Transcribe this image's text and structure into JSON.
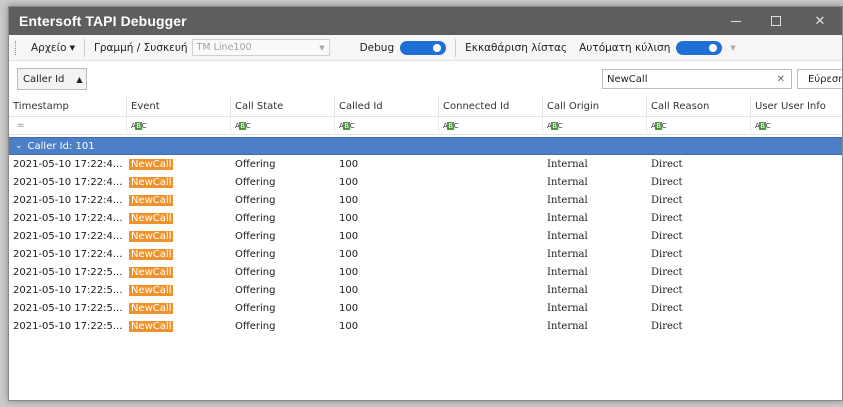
{
  "window": {
    "title": "Entersoft TAPI Debugger"
  },
  "toolbar": {
    "file_menu": "Αρχείο",
    "line_device_label": "Γραμμή / Συσκευή",
    "line_device_value": "TM Line100",
    "debug_label": "Debug",
    "debug_on": true,
    "clear_list_label": "Εκκαθάριση λίστας",
    "auto_scroll_label": "Αυτόματη κύλιση",
    "auto_scroll_on": true
  },
  "group_panel": {
    "group_field": "Caller Id"
  },
  "search": {
    "value": "NewCall",
    "find_label": "Εύρεση"
  },
  "grid": {
    "columns": [
      "Timestamp",
      "Event",
      "Call State",
      "Called Id",
      "Connected Id",
      "Call Origin",
      "Call Reason",
      "User User Info"
    ],
    "filter_eq": "=",
    "filter_abc": "ABC",
    "group_label": "Caller Id: 101",
    "rows": [
      {
        "timestamp": "2021-05-10 17:22:4...",
        "event": "NewCall",
        "state": "Offering",
        "called": "100",
        "connected": "",
        "origin": "Internal",
        "reason": "Direct",
        "uui": ""
      },
      {
        "timestamp": "2021-05-10 17:22:4...",
        "event": "NewCall",
        "state": "Offering",
        "called": "100",
        "connected": "",
        "origin": "Internal",
        "reason": "Direct",
        "uui": ""
      },
      {
        "timestamp": "2021-05-10 17:22:4...",
        "event": "NewCall",
        "state": "Offering",
        "called": "100",
        "connected": "",
        "origin": "Internal",
        "reason": "Direct",
        "uui": ""
      },
      {
        "timestamp": "2021-05-10 17:22:4...",
        "event": "NewCall",
        "state": "Offering",
        "called": "100",
        "connected": "",
        "origin": "Internal",
        "reason": "Direct",
        "uui": ""
      },
      {
        "timestamp": "2021-05-10 17:22:4...",
        "event": "NewCall",
        "state": "Offering",
        "called": "100",
        "connected": "",
        "origin": "Internal",
        "reason": "Direct",
        "uui": ""
      },
      {
        "timestamp": "2021-05-10 17:22:4...",
        "event": "NewCall",
        "state": "Offering",
        "called": "100",
        "connected": "",
        "origin": "Internal",
        "reason": "Direct",
        "uui": ""
      },
      {
        "timestamp": "2021-05-10 17:22:5...",
        "event": "NewCall",
        "state": "Offering",
        "called": "100",
        "connected": "",
        "origin": "Internal",
        "reason": "Direct",
        "uui": ""
      },
      {
        "timestamp": "2021-05-10 17:22:5...",
        "event": "NewCall",
        "state": "Offering",
        "called": "100",
        "connected": "",
        "origin": "Internal",
        "reason": "Direct",
        "uui": ""
      },
      {
        "timestamp": "2021-05-10 17:22:5...",
        "event": "NewCall",
        "state": "Offering",
        "called": "100",
        "connected": "",
        "origin": "Internal",
        "reason": "Direct",
        "uui": ""
      },
      {
        "timestamp": "2021-05-10 17:22:5...",
        "event": "NewCall",
        "state": "Offering",
        "called": "100",
        "connected": "",
        "origin": "Internal",
        "reason": "Direct",
        "uui": ""
      }
    ]
  },
  "colors": {
    "titlebar": "#5e5e5e",
    "toggle": "#1f6fd6",
    "group_row": "#4d7fc6",
    "highlight": "#f0922c"
  }
}
